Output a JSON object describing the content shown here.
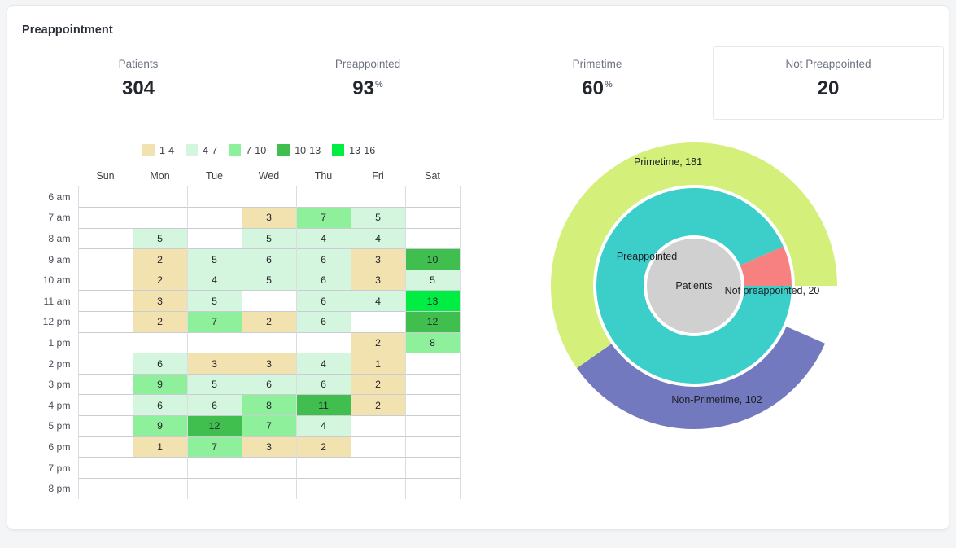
{
  "card": {
    "title": "Preappointment"
  },
  "kpis": [
    {
      "name": "patients",
      "label": "Patients",
      "value": "304",
      "suffix": "",
      "boxed": false
    },
    {
      "name": "preappointed",
      "label": "Preappointed",
      "value": "93",
      "suffix": "%",
      "boxed": false
    },
    {
      "name": "primetime",
      "label": "Primetime",
      "value": "60",
      "suffix": "%",
      "boxed": false
    },
    {
      "name": "not-preappointed",
      "label": "Not Preappointed",
      "value": "20",
      "suffix": "",
      "boxed": true
    }
  ],
  "legend": [
    {
      "label": "1-4",
      "color": "#f2e2b0"
    },
    {
      "label": "4-7",
      "color": "#d4f6de"
    },
    {
      "label": "7-10",
      "color": "#8ef09a"
    },
    {
      "label": "10-13",
      "color": "#41bf4e"
    },
    {
      "label": "13-16",
      "color": "#00ee44"
    }
  ],
  "chart_data": [
    {
      "type": "heatmap",
      "title": "Appointments by day and hour",
      "xlabel": "",
      "ylabel": "",
      "grid": true,
      "categories": [
        "Sun",
        "Mon",
        "Tue",
        "Wed",
        "Thu",
        "Fri",
        "Sat"
      ],
      "rows": [
        "6 am",
        "7 am",
        "8 am",
        "9 am",
        "10 am",
        "11 am",
        "12 pm",
        "1 pm",
        "2 pm",
        "3 pm",
        "4 pm",
        "5 pm",
        "6 pm",
        "7 pm",
        "8 pm"
      ],
      "bins": [
        {
          "label": "1-4",
          "min": 1,
          "max": 4,
          "color": "#f2e2b0"
        },
        {
          "label": "4-7",
          "min": 4,
          "max": 7,
          "color": "#d4f6de"
        },
        {
          "label": "7-10",
          "min": 7,
          "max": 10,
          "color": "#8ef09a"
        },
        {
          "label": "10-13",
          "min": 10,
          "max": 13,
          "color": "#41bf4e"
        },
        {
          "label": "13-16",
          "min": 13,
          "max": 16,
          "color": "#00ee44"
        }
      ],
      "values": [
        [
          null,
          null,
          null,
          null,
          null,
          null,
          null
        ],
        [
          null,
          null,
          null,
          3,
          7,
          5,
          null
        ],
        [
          null,
          5,
          null,
          5,
          4,
          4,
          null
        ],
        [
          null,
          2,
          5,
          6,
          6,
          3,
          10
        ],
        [
          null,
          2,
          4,
          5,
          6,
          3,
          5
        ],
        [
          null,
          3,
          5,
          null,
          6,
          4,
          13
        ],
        [
          null,
          2,
          7,
          2,
          6,
          null,
          12
        ],
        [
          null,
          null,
          null,
          null,
          null,
          2,
          8
        ],
        [
          null,
          6,
          3,
          3,
          4,
          1,
          null
        ],
        [
          null,
          9,
          5,
          6,
          6,
          2,
          null
        ],
        [
          null,
          6,
          6,
          8,
          11,
          2,
          null
        ],
        [
          null,
          9,
          12,
          7,
          4,
          null,
          null
        ],
        [
          null,
          1,
          7,
          3,
          2,
          null,
          null
        ],
        [
          null,
          null,
          null,
          null,
          null,
          null,
          null
        ],
        [
          null,
          null,
          null,
          null,
          null,
          null,
          null
        ]
      ]
    },
    {
      "type": "pie",
      "subtype": "sunburst",
      "title": "",
      "center_label": "Patients",
      "rings": [
        {
          "name": "center",
          "slices": [
            {
              "label": "Patients",
              "value": 304,
              "color": "#d0d0d0"
            }
          ]
        },
        {
          "name": "preappointment",
          "slices": [
            {
              "label": "Preappointed",
              "value": 283,
              "color": "#3ccfc9",
              "annotation": "Preappointed"
            },
            {
              "label": "Not preappointed",
              "value": 20,
              "color": "#f78080",
              "annotation": "Not preappointed, 20"
            }
          ]
        },
        {
          "name": "time-of-day",
          "slices": [
            {
              "label": "Primetime",
              "value": 181,
              "color": "#d4f07a",
              "annotation": "Primetime, 181"
            },
            {
              "label": "Non-Primetime",
              "value": 102,
              "color": "#7379be",
              "annotation": "Non-Primetime, 102"
            }
          ]
        }
      ]
    }
  ]
}
